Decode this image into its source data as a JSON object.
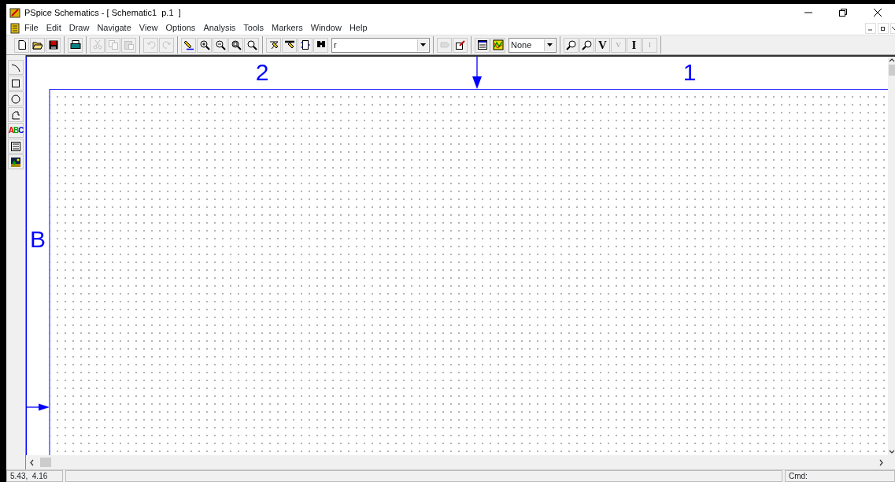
{
  "window": {
    "title": "PSpice Schematics - [ Schematic1  p.1  ]"
  },
  "menu": [
    {
      "label": "File"
    },
    {
      "label": "Edit"
    },
    {
      "label": "Draw"
    },
    {
      "label": "Navigate"
    },
    {
      "label": "View"
    },
    {
      "label": "Options"
    },
    {
      "label": "Analysis"
    },
    {
      "label": "Tools"
    },
    {
      "label": "Markers"
    },
    {
      "label": "Window"
    },
    {
      "label": "Help"
    }
  ],
  "toolbar": [
    [
      {
        "kind": "new",
        "disabled": false
      },
      {
        "kind": "open",
        "disabled": false
      },
      {
        "kind": "save",
        "disabled": false
      }
    ],
    [
      {
        "kind": "print",
        "disabled": false
      }
    ],
    [
      {
        "kind": "cut",
        "disabled": true
      },
      {
        "kind": "copy",
        "disabled": true
      },
      {
        "kind": "paste",
        "disabled": true
      }
    ],
    [
      {
        "kind": "undo",
        "disabled": true
      },
      {
        "kind": "redo",
        "disabled": true
      }
    ],
    [
      {
        "kind": "redraw",
        "disabled": false
      },
      {
        "kind": "zoom-in",
        "disabled": false
      },
      {
        "kind": "zoom-out",
        "disabled": false
      },
      {
        "kind": "zoom-area",
        "disabled": false
      },
      {
        "kind": "zoom-fit",
        "disabled": false
      }
    ],
    [
      {
        "kind": "wire",
        "disabled": false
      },
      {
        "kind": "bus",
        "disabled": false
      },
      {
        "kind": "block",
        "disabled": false
      },
      {
        "kind": "find",
        "disabled": false
      },
      {
        "kind": "combo",
        "value": "r"
      }
    ],
    [
      {
        "kind": "part",
        "disabled": true
      },
      {
        "kind": "edit-symbol",
        "disabled": false
      }
    ],
    [
      {
        "kind": "setup",
        "disabled": false
      },
      {
        "kind": "simulate",
        "disabled": false
      },
      {
        "kind": "combo",
        "value": "None"
      }
    ],
    [
      {
        "kind": "probe",
        "disabled": false
      },
      {
        "kind": "probe",
        "disabled": false
      },
      {
        "kind": "letter",
        "label": "V",
        "disabled": false
      },
      {
        "kind": "diff",
        "label": "V",
        "disabled": true
      },
      {
        "kind": "letter",
        "label": "I",
        "disabled": false
      },
      {
        "kind": "diff",
        "label": "I",
        "disabled": true
      }
    ]
  ],
  "draw_tools": [
    {
      "kind": "arc"
    },
    {
      "kind": "box"
    },
    {
      "kind": "circle"
    },
    {
      "kind": "polyline"
    },
    {
      "kind": "text",
      "label": "ABC"
    },
    {
      "kind": "textbox"
    },
    {
      "kind": "picture"
    }
  ],
  "canvas": {
    "border_labels": [
      {
        "text": "2"
      },
      {
        "text": "1"
      },
      {
        "text": "B"
      }
    ]
  },
  "status_bar": {
    "coordinates": "5.43,  4.16",
    "command_label": "Cmd:"
  }
}
